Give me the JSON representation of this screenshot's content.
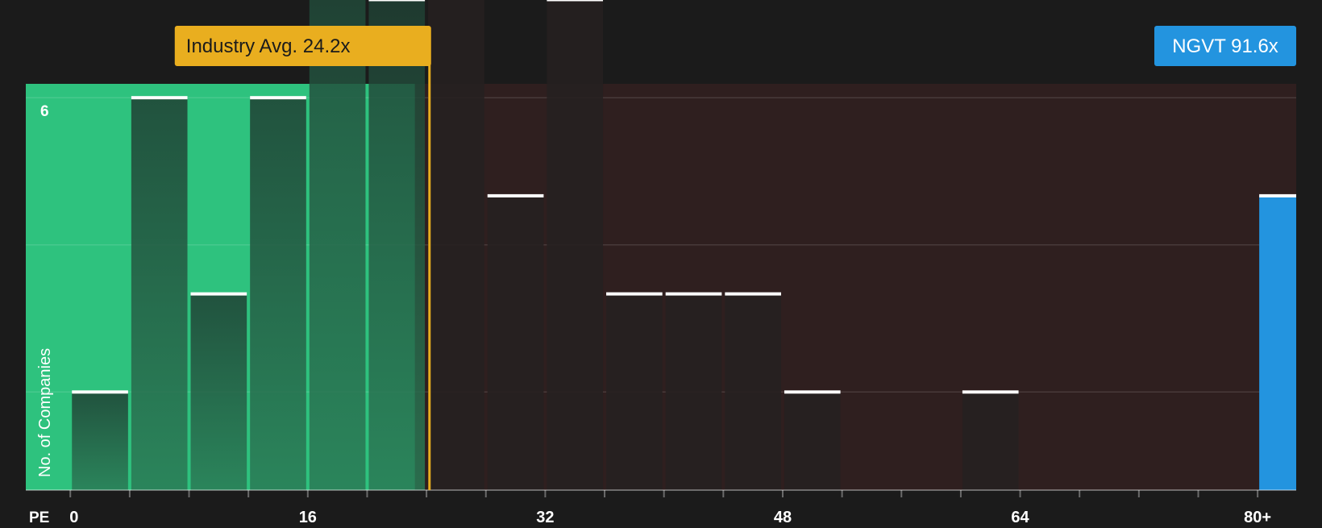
{
  "chart_data": {
    "type": "bar",
    "title": "",
    "xlabel": "PE",
    "ylabel": "No. of Companies",
    "ylim": [
      0,
      6
    ],
    "y_tick_labels": [
      {
        "value": 6,
        "label": "6"
      }
    ],
    "bin_width": 4,
    "x_range": [
      -3,
      82.6
    ],
    "x_ticks": [
      {
        "value": 0,
        "label": "0"
      },
      {
        "value": 16,
        "label": "16"
      },
      {
        "value": 32,
        "label": "32"
      },
      {
        "value": 48,
        "label": "48"
      },
      {
        "value": 64,
        "label": "64"
      },
      {
        "value": 80,
        "label": "80+"
      }
    ],
    "bins": [
      {
        "start": 0,
        "count": 1
      },
      {
        "start": 4,
        "count": 4
      },
      {
        "start": 8,
        "count": 2
      },
      {
        "start": 12,
        "count": 4
      },
      {
        "start": 16,
        "count": 6
      },
      {
        "start": 20,
        "count": 5
      },
      {
        "start": 24,
        "count": 6
      },
      {
        "start": 28,
        "count": 3
      },
      {
        "start": 32,
        "count": 5
      },
      {
        "start": 36,
        "count": 2
      },
      {
        "start": 40,
        "count": 2
      },
      {
        "start": 44,
        "count": 2
      },
      {
        "start": 48,
        "count": 1
      },
      {
        "start": 52,
        "count": 0
      },
      {
        "start": 56,
        "count": 0
      },
      {
        "start": 60,
        "count": 1
      },
      {
        "start": 64,
        "count": 0
      },
      {
        "start": 68,
        "count": 0
      },
      {
        "start": 72,
        "count": 0
      },
      {
        "start": 76,
        "count": 0
      },
      {
        "start": 80,
        "count": 3
      }
    ],
    "industry_avg": {
      "value": 24.2,
      "label": "Industry Avg. 24.2x"
    },
    "company": {
      "ticker": "NGVT",
      "value": 91.6,
      "label": "NGVT 91.6x"
    },
    "grid": true
  },
  "colors": {
    "background": "#1b1b1b",
    "below_avg_region": "#2ec27e",
    "above_avg_region": "#2f1f1f",
    "bar_dark": "#1e2a24",
    "bar_cap": "#ffffff",
    "avg_line": "#e9ae1f",
    "company_bar": "#2394df",
    "gridline": "#4a3a3a"
  }
}
